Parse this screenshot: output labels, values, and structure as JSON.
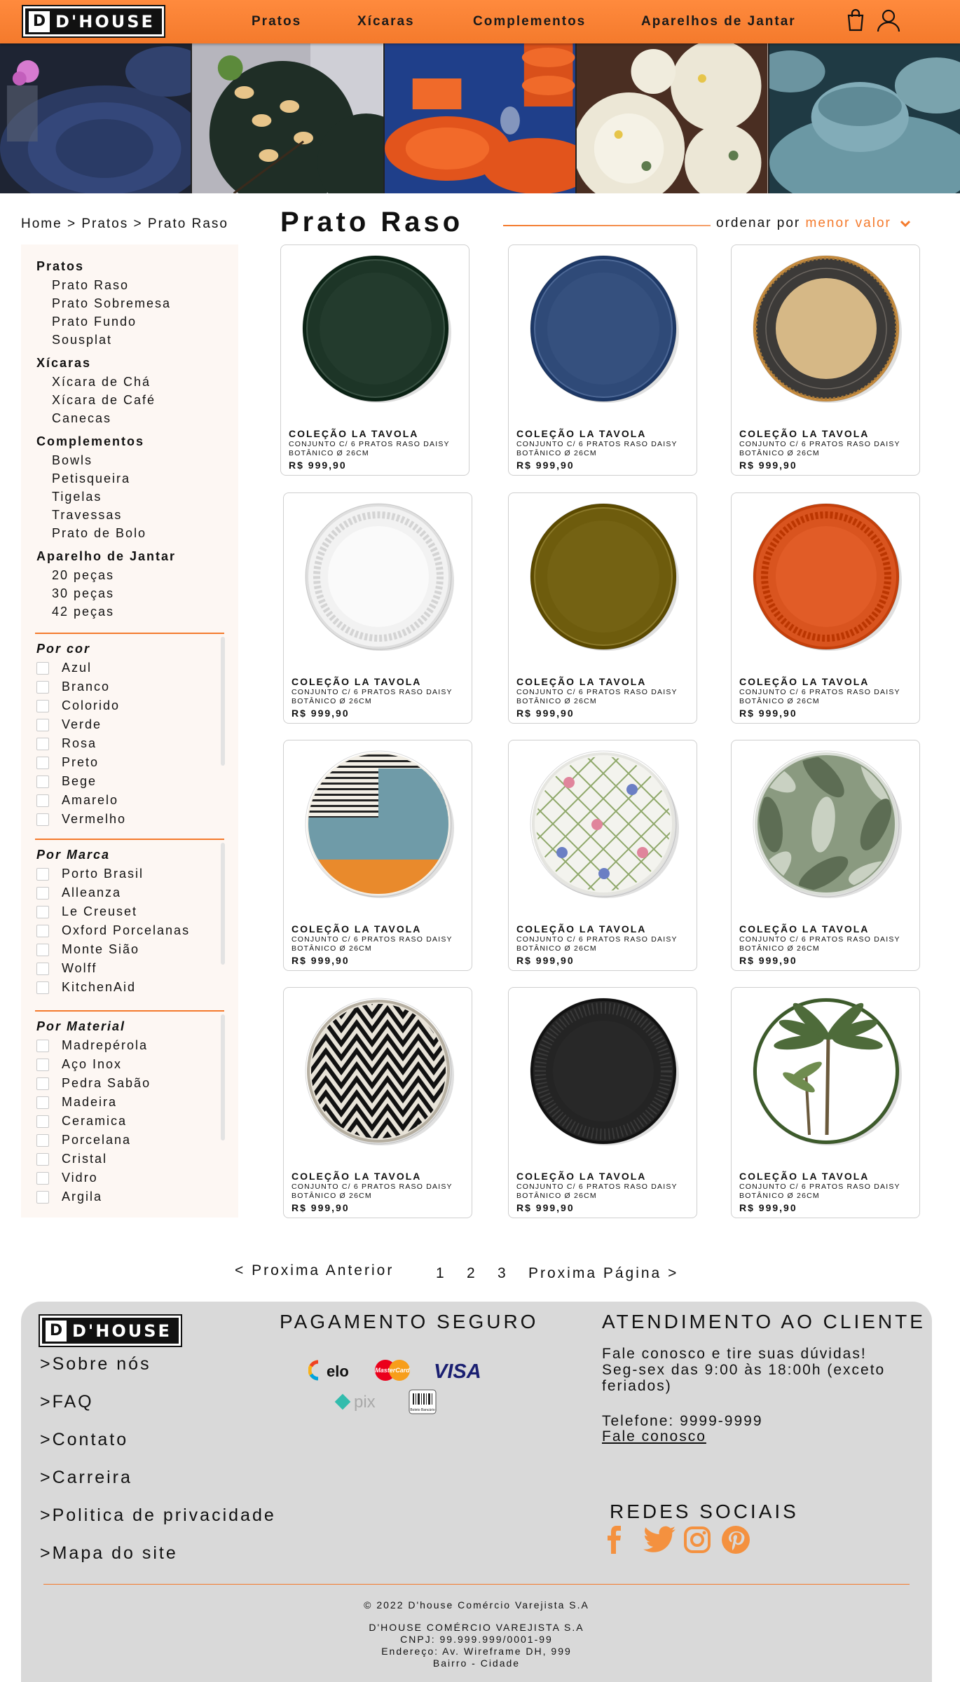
{
  "brand": {
    "logo_letter": "D",
    "name": "D'HOUSE"
  },
  "nav": [
    "Pratos",
    "Xícaras",
    "Complementos",
    "Aparelhos de Jantar"
  ],
  "header_icons": [
    "shopping-bag-icon",
    "user-icon"
  ],
  "colors": {
    "accent": "#f47a2c",
    "sidebar_bg": "#fdf7f3",
    "footer_bg": "#d9d9d9"
  },
  "breadcrumb": "Home > Pratos > Prato Raso",
  "page_title": "Prato Raso",
  "sort": {
    "label": "ordenar por",
    "value": "menor valor"
  },
  "sidebar": {
    "categories": [
      {
        "name": "Pratos",
        "items": [
          "Prato Raso",
          "Prato Sobremesa",
          "Prato Fundo",
          "Sousplat"
        ]
      },
      {
        "name": "Xícaras",
        "items": [
          "Xícara de Chá",
          "Xícara de Café",
          "Canecas"
        ]
      },
      {
        "name": "Complementos",
        "items": [
          "Bowls",
          "Petisqueira",
          "Tigelas",
          "Travessas",
          "Prato de Bolo"
        ]
      },
      {
        "name": "Aparelho de Jantar",
        "items": [
          "20 peças",
          "30 peças",
          "42 peças"
        ]
      }
    ],
    "filters": [
      {
        "title": "Por cor",
        "options": [
          "Azul",
          "Branco",
          "Colorido",
          "Verde",
          "Rosa",
          "Preto",
          "Bege",
          "Amarelo",
          "Vermelho"
        ]
      },
      {
        "title": "Por Marca",
        "options": [
          "Porto Brasil",
          "Alleanza",
          "Le Creuset",
          "Oxford Porcelanas",
          "Monte Sião",
          "Wolff",
          "KitchenAid"
        ]
      },
      {
        "title": "Por Material",
        "options": [
          "Madrepérola",
          "Aço Inox",
          "Pedra Sabão",
          "Madeira",
          "Ceramica",
          "Porcelana",
          "Cristal",
          "Vidro",
          "Argila"
        ]
      }
    ]
  },
  "products": [
    {
      "collection": "COLEÇÃO LA TAVOLA",
      "description": "CONJUNTO C/ 6 PRATOS RASO DAISY BOTÂNICO Ø 26CM",
      "price": "R$ 999,90",
      "plate_style": "solid",
      "color": "#1d3527"
    },
    {
      "collection": "COLEÇÃO LA TAVOLA",
      "description": "CONJUNTO C/ 6 PRATOS RASO DAISY BOTÂNICO Ø 26CM",
      "price": "R$ 999,90",
      "plate_style": "solid",
      "color": "#2f4a78"
    },
    {
      "collection": "COLEÇÃO LA TAVOLA",
      "description": "CONJUNTO C/ 6 PRATOS RASO DAISY BOTÂNICO Ø 26CM",
      "price": "R$ 999,90",
      "plate_style": "rim",
      "color": "#d6b886",
      "rim": "#3c3a38"
    },
    {
      "collection": "COLEÇÃO LA TAVOLA",
      "description": "CONJUNTO C/ 6 PRATOS RASO DAISY BOTÂNICO Ø 26CM",
      "price": "R$ 999,90",
      "plate_style": "lace",
      "color": "#f2f2f2"
    },
    {
      "collection": "COLEÇÃO LA TAVOLA",
      "description": "CONJUNTO C/ 6 PRATOS RASO DAISY BOTÂNICO Ø 26CM",
      "price": "R$ 999,90",
      "plate_style": "solid",
      "color": "#6e5c0d"
    },
    {
      "collection": "COLEÇÃO LA TAVOLA",
      "description": "CONJUNTO C/ 6 PRATOS RASO DAISY BOTÂNICO Ø 26CM",
      "price": "R$ 999,90",
      "plate_style": "lace",
      "color": "#d9541f"
    },
    {
      "collection": "COLEÇÃO LA TAVOLA",
      "description": "CONJUNTO C/ 6 PRATOS RASO DAISY BOTÂNICO Ø 26CM",
      "price": "R$ 999,90",
      "plate_style": "split",
      "color": "#e98a2c"
    },
    {
      "collection": "COLEÇÃO LA TAVOLA",
      "description": "CONJUNTO C/ 6 PRATOS RASO DAISY BOTÂNICO Ø 26CM",
      "price": "R$ 999,90",
      "plate_style": "floral",
      "color": "#f3f3ee"
    },
    {
      "collection": "COLEÇÃO LA TAVOLA",
      "description": "CONJUNTO C/ 6 PRATOS RASO DAISY BOTÂNICO Ø 26CM",
      "price": "R$ 999,90",
      "plate_style": "leaves",
      "color": "#8a9a80"
    },
    {
      "collection": "COLEÇÃO LA TAVOLA",
      "description": "CONJUNTO C/ 6 PRATOS RASO DAISY BOTÂNICO Ø 26CM",
      "price": "R$ 999,90",
      "plate_style": "zigzag",
      "color": "#e8e3d8"
    },
    {
      "collection": "COLEÇÃO LA TAVOLA",
      "description": "CONJUNTO C/ 6 PRATOS RASO DAISY BOTÂNICO Ø 26CM",
      "price": "R$ 999,90",
      "plate_style": "ribbed",
      "color": "#242424"
    },
    {
      "collection": "COLEÇÃO LA TAVOLA",
      "description": "CONJUNTO C/ 6 PRATOS RASO DAISY BOTÂNICO Ø 26CM",
      "price": "R$ 999,90",
      "plate_style": "palm",
      "color": "#ffffff"
    }
  ],
  "pagination": {
    "prev": "< Proxima Anterior",
    "pages": [
      "1",
      "2",
      "3"
    ],
    "next": "Proxima Página >"
  },
  "footer": {
    "links": [
      ">Sobre nós",
      ">FAQ",
      ">Contato",
      ">Carreira",
      ">Politica de privacidade",
      ">Mapa do site"
    ],
    "payment_title": "PAGAMENTO SEGURO",
    "payment_methods": {
      "elo": "elo",
      "mastercard": "MasterCard",
      "visa": "VISA",
      "pix": "pix",
      "boleto": "Boleto Bancário"
    },
    "service_title": "ATENDIMENTO AO CLIENTE",
    "service_text": "Fale conosco e tire suas dúvidas!\nSeg-sex das 9:00 às 18:00h (exceto feriados)",
    "phone": "Telefone: 9999-9999",
    "contact_link": "Fale conosco",
    "social_title": "REDES SOCIAIS",
    "social_icons": [
      "facebook-icon",
      "twitter-icon",
      "instagram-icon",
      "pinterest-icon"
    ],
    "copyright": "© 2022 D'house Comércio Varejista S.A",
    "legal": [
      "D'HOUSE COMÉRCIO VAREJISTA S.A",
      "CNPJ: 99.999.999/0001-99",
      "Endereço: Av. Wireframe DH, 999",
      "Bairro - Cidade"
    ]
  }
}
